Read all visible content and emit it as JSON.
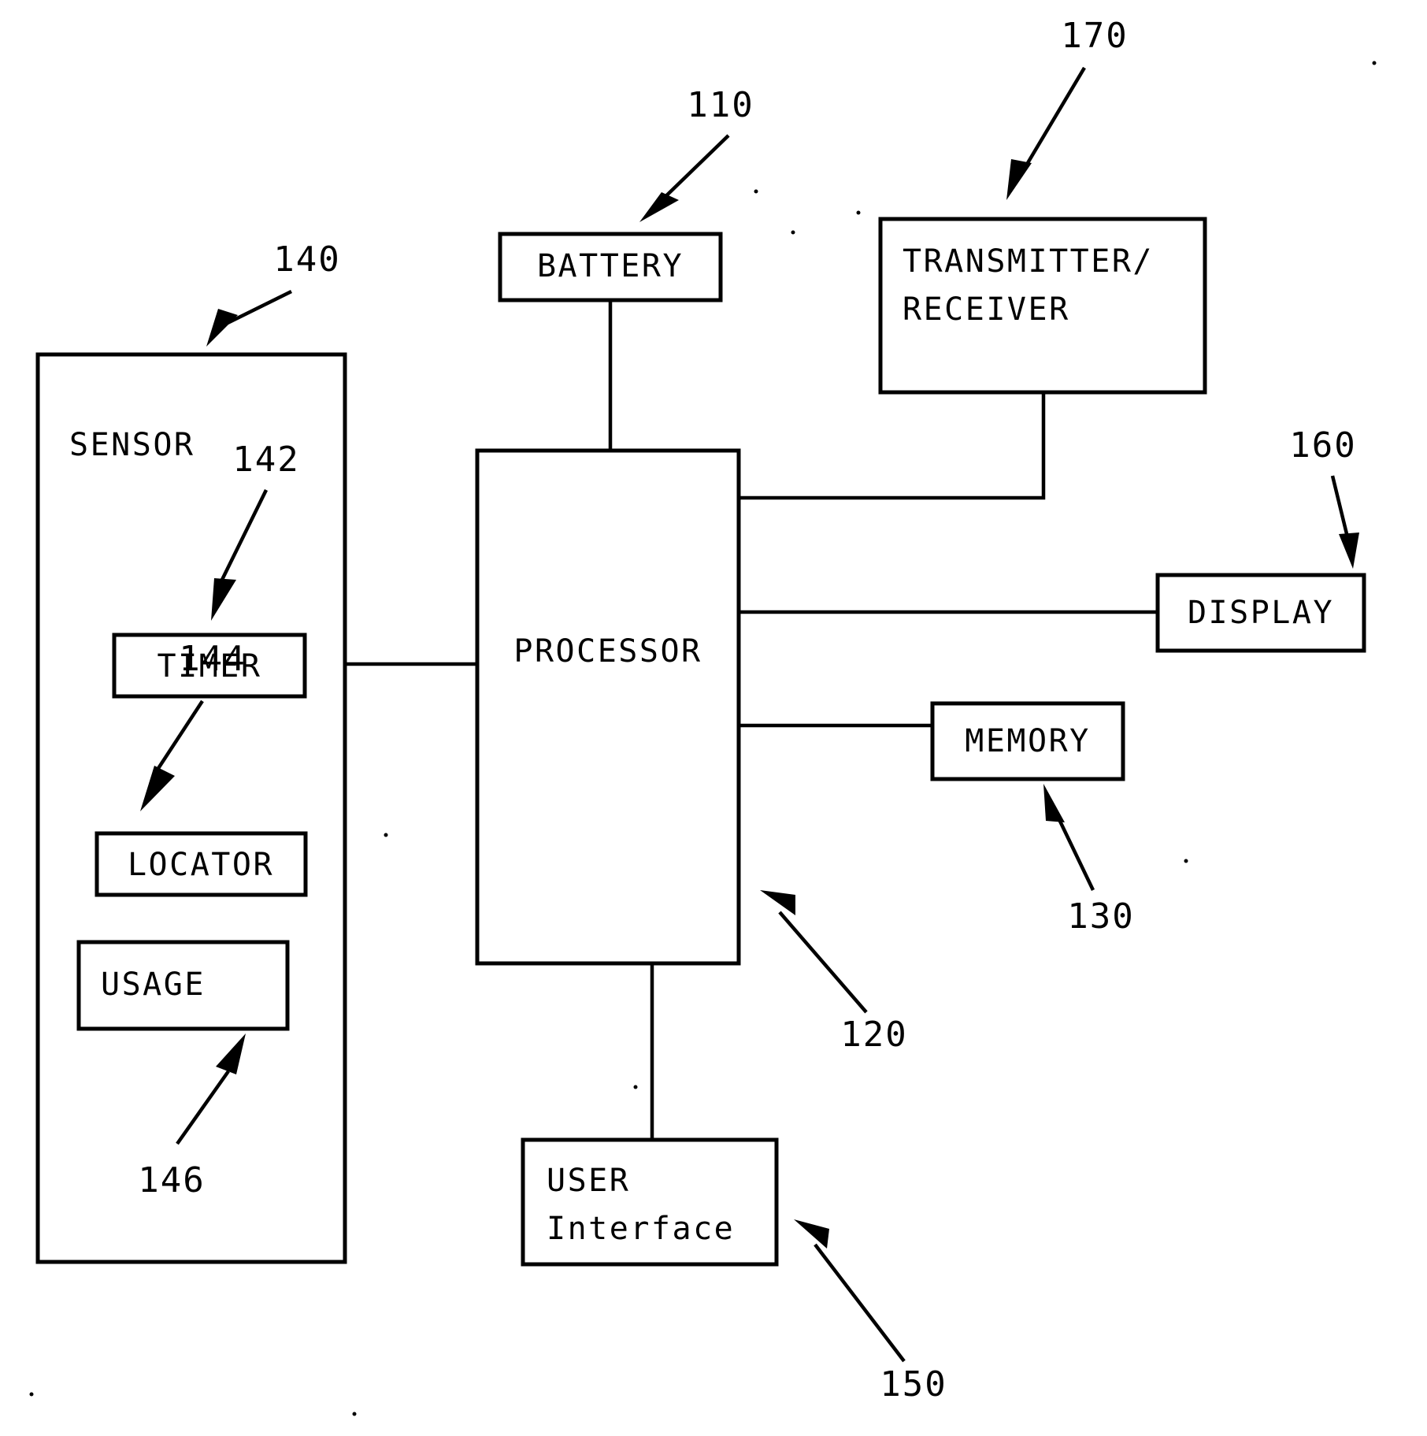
{
  "figure": {
    "kind": "patent-block-diagram",
    "background_color": "#ffffff",
    "ink_color": "#000000"
  },
  "blocks": {
    "battery": {
      "label": "BATTERY"
    },
    "transmitter_receiver": {
      "label_line1": "TRANSMITTER/",
      "label_line2": "RECEIVER"
    },
    "sensor": {
      "label": "SENSOR"
    },
    "timer": {
      "label": "TIMER"
    },
    "locator": {
      "label": "LOCATOR"
    },
    "usage": {
      "label": "USAGE"
    },
    "processor": {
      "label": "PROCESSOR"
    },
    "display": {
      "label": "DISPLAY"
    },
    "memory": {
      "label": "MEMORY"
    },
    "user_interface": {
      "label_line1": "USER",
      "label_line2": "Interface"
    }
  },
  "reference_numerals": {
    "battery": "110",
    "processor": "120",
    "memory": "130",
    "sensor": "140",
    "timer": "142",
    "locator": "144",
    "usage": "146",
    "user_interface": "150",
    "display": "160",
    "transmitter_receiver": "170"
  }
}
